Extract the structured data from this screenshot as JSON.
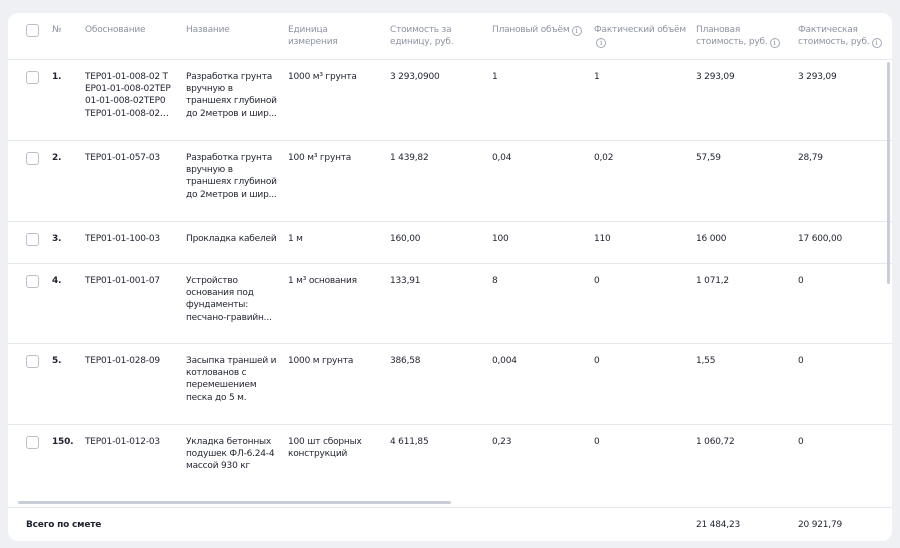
{
  "header": {
    "no": "№",
    "basis": "Обоснование",
    "name": "Название",
    "unit": "Единица измерения",
    "unit_cost": "Стоимость за единицу, руб.",
    "planned_volume": "Плановый объём",
    "actual_volume": "Фактический объём",
    "planned_cost": "Плановая стоимость, руб.",
    "actual_cost": "Фактическая стоимость, руб."
  },
  "rows": [
    {
      "no": "1.",
      "basis": "ТЕР01-01-008-02 ТЕР01-01-008-02ТЕР01-01-008-02ТЕР0 ТЕР01-01-008-021...",
      "name": "Разработка грунта вручную в траншеях глубиной до 2метров и шир...",
      "unit": "1000 м³ грунта",
      "unit_cost": "3 293,0900",
      "planned_volume": "1",
      "actual_volume": "1",
      "planned_cost": "3 293,09",
      "actual_cost": "3 293,09"
    },
    {
      "no": "2.",
      "basis": "ТЕР01-01-057-03",
      "name": "Разработка грунта вручную в траншеях глубиной до 2метров и шир...",
      "unit": "100 м³ грунта",
      "unit_cost": "1 439,82",
      "planned_volume": "0,04",
      "actual_volume": "0,02",
      "planned_cost": "57,59",
      "actual_cost": "28,79"
    },
    {
      "no": "3.",
      "basis": "ТЕР01-01-100-03",
      "name": "Прокладка кабелей",
      "unit": "1 м",
      "unit_cost": "160,00",
      "planned_volume": "100",
      "actual_volume": "110",
      "planned_cost": "16 000",
      "actual_cost": "17 600,00"
    },
    {
      "no": "4.",
      "basis": "ТЕР01-01-001-07",
      "name": "Устройство основания под фундаменты: песчано-гравийн...",
      "unit": "1 м³ основания",
      "unit_cost": "133,91",
      "planned_volume": "8",
      "actual_volume": "0",
      "planned_cost": "1 071,2",
      "actual_cost": "0"
    },
    {
      "no": "5.",
      "basis": "ТЕР01-01-028-09",
      "name": "Засыпка траншей и котлованов с перемешением песка до 5 м.",
      "unit": "1000 м грунта",
      "unit_cost": "386,58",
      "planned_volume": "0,004",
      "actual_volume": "0",
      "planned_cost": "1,55",
      "actual_cost": "0"
    },
    {
      "no": "150.",
      "basis": "ТЕР01-01-012-03",
      "name": "Укладка бетонных подушек ФЛ-6.24-4 массой 930 кг",
      "unit": "100 шт сборных конструкций",
      "unit_cost": "4 611,85",
      "planned_volume": "0,23",
      "actual_volume": "0",
      "planned_cost": "1 060,72",
      "actual_cost": "0"
    }
  ],
  "footer": {
    "label": "Всего по смете",
    "planned_total": "21 484,23",
    "actual_total": "20 921,79"
  },
  "icons": {
    "info": "i"
  }
}
